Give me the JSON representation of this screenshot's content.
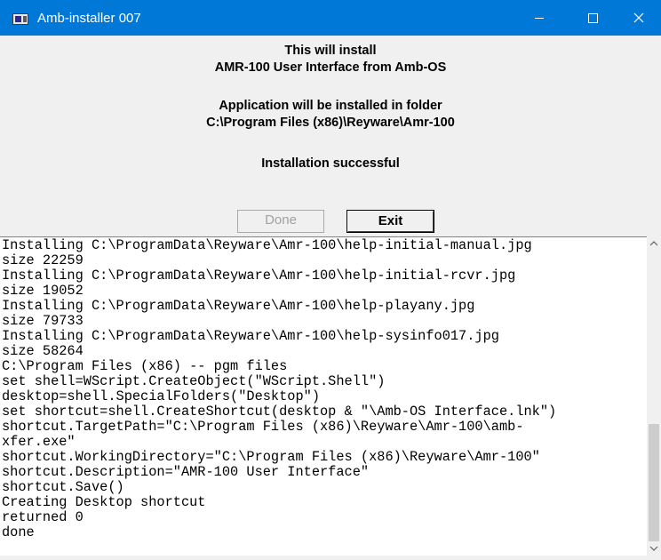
{
  "window": {
    "title": "Amb-installer 007"
  },
  "header": {
    "line1": "This will install",
    "line2": "AMR-100 User Interface from Amb-OS",
    "line3": "Application will be installed in folder",
    "line4": "C:\\Program Files (x86)\\Reyware\\Amr-100",
    "status": "Installation successful"
  },
  "buttons": {
    "done_label": "Done",
    "done_enabled": false,
    "exit_label": "Exit"
  },
  "log": {
    "lines": [
      "Installing C:\\ProgramData\\Reyware\\Amr-100\\help-initial-manual.jpg",
      "size 22259",
      "Installing C:\\ProgramData\\Reyware\\Amr-100\\help-initial-rcvr.jpg",
      "size 19052",
      "Installing C:\\ProgramData\\Reyware\\Amr-100\\help-playany.jpg",
      "size 79733",
      "Installing C:\\ProgramData\\Reyware\\Amr-100\\help-sysinfo017.jpg",
      "size 58264",
      "C:\\Program Files (x86) -- pgm files",
      "set shell=WScript.CreateObject(\"WScript.Shell\")",
      "desktop=shell.SpecialFolders(\"Desktop\")",
      "set shortcut=shell.CreateShortcut(desktop & \"\\Amb-OS Interface.lnk\")",
      "shortcut.TargetPath=\"C:\\Program Files (x86)\\Reyware\\Amr-100\\amb-",
      "xfer.exe\"",
      "shortcut.WorkingDirectory=\"C:\\Program Files (x86)\\Reyware\\Amr-100\"",
      "shortcut.Description=\"AMR-100 User Interface\"",
      "shortcut.Save()",
      "Creating Desktop shortcut",
      "returned 0",
      "done"
    ]
  },
  "scrollbar": {
    "position_fraction": 1.0
  },
  "colors": {
    "titlebar": "#0078d7",
    "window_bg": "#f0f0f0",
    "log_bg": "#ffffff",
    "disabled_text": "#a0a0a0"
  },
  "icons": {
    "app": "installer-app-icon",
    "minimize": "minimize-icon",
    "maximize": "maximize-icon",
    "close": "close-icon",
    "scroll_up": "chevron-up-icon",
    "scroll_down": "chevron-down-icon"
  }
}
